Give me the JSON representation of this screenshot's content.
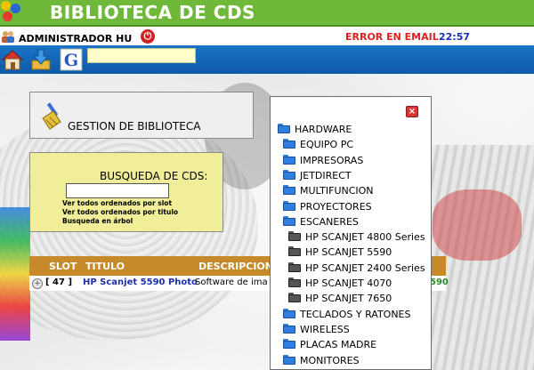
{
  "header": {
    "title": "BIBLIOTECA DE CDS",
    "logo_colors": [
      "#f0c200",
      "#2a66d6",
      "#e23c2c"
    ]
  },
  "infobar": {
    "user": "ADMINISTRADOR HU",
    "status": "ERROR EN EMAIL",
    "time": "22:57"
  },
  "toolbar": {
    "icons": [
      "home-icon",
      "download-icon",
      "google-icon"
    ],
    "search_value": ""
  },
  "gestion": {
    "label": "GESTION DE BIBLIOTECA"
  },
  "busqueda": {
    "title": "BUSQUEDA DE CDS:",
    "input_value": "",
    "links": [
      "Ver todos ordenados por slot",
      "Ver todos ordenados por titulo",
      "Busqueda en árbol"
    ]
  },
  "table": {
    "headers": [
      "SLOT",
      "TITULO",
      "DESCRIPCION"
    ],
    "row": {
      "slot": "[ 47 ]",
      "title": "HP Scanjet 5590 Photo",
      "desc": "Software de ima",
      "code": "590"
    }
  },
  "tree": {
    "items": [
      {
        "label": "HARDWARE",
        "depth": 0,
        "open": true
      },
      {
        "label": "EQUIPO PC",
        "depth": 1,
        "open": false
      },
      {
        "label": "IMPRESORAS",
        "depth": 1,
        "open": false
      },
      {
        "label": "JETDIRECT",
        "depth": 1,
        "open": false
      },
      {
        "label": "MULTIFUNCION",
        "depth": 1,
        "open": false
      },
      {
        "label": "PROYECTORES",
        "depth": 1,
        "open": false
      },
      {
        "label": "ESCANERES",
        "depth": 1,
        "open": true
      },
      {
        "label": "HP SCANJET 4800 Series",
        "depth": 2,
        "open": false
      },
      {
        "label": "HP SCANJET 5590",
        "depth": 2,
        "open": false
      },
      {
        "label": "HP SCANJET 2400 Series",
        "depth": 2,
        "open": false
      },
      {
        "label": "HP SCANJET 4070",
        "depth": 2,
        "open": false
      },
      {
        "label": "HP SCANJET 7650",
        "depth": 2,
        "open": false
      },
      {
        "label": "TECLADOS Y RATONES",
        "depth": 1,
        "open": false
      },
      {
        "label": "WIRELESS",
        "depth": 1,
        "open": false
      },
      {
        "label": "PLACAS MADRE",
        "depth": 1,
        "open": false
      },
      {
        "label": "MONITORES",
        "depth": 1,
        "open": false
      }
    ]
  }
}
